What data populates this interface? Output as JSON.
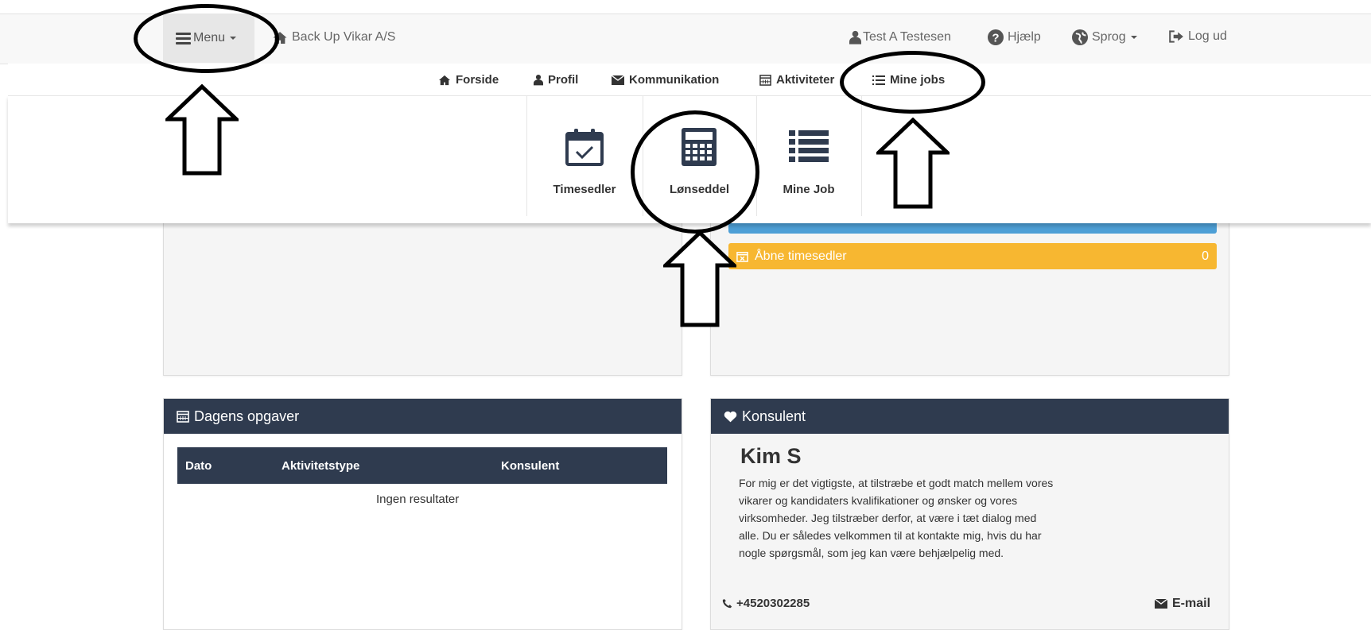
{
  "topbar": {
    "menu_label": "Menu",
    "company": "Back Up Vikar A/S",
    "user": "Test A Testesen",
    "help": "Hjælp",
    "language": "Sprog",
    "logout": "Log ud"
  },
  "subnav": {
    "items": [
      {
        "label": "Forside",
        "icon": "home-icon"
      },
      {
        "label": "Profil",
        "icon": "user-icon"
      },
      {
        "label": "Kommunikation",
        "icon": "envelope-icon"
      },
      {
        "label": "Aktiviteter",
        "icon": "calendar-icon"
      },
      {
        "label": "Mine jobs",
        "icon": "list-icon"
      }
    ]
  },
  "dropdown": {
    "tiles": [
      {
        "label": "Timesedler",
        "icon": "calendar-check-icon"
      },
      {
        "label": "Lønseddel",
        "icon": "calculator-icon"
      },
      {
        "label": "Mine Job",
        "icon": "list-icon"
      }
    ]
  },
  "status_bars": {
    "open_timesheets": {
      "label": "Åbne timesedler",
      "count": "0",
      "color": "#f7b731"
    },
    "blue_bar_color": "#2f8fd0"
  },
  "tasks_panel": {
    "title": "Dagens opgaver",
    "columns": [
      "Dato",
      "Aktivitetstype",
      "Konsulent"
    ],
    "empty_text": "Ingen resultater"
  },
  "consultant_panel": {
    "title": "Konsulent",
    "name": "Kim S",
    "bio_lines": [
      "For mig er det vigtigste, at tilstræbe et godt match mellem vores",
      "vikarer og kandidaters kvalifikationer og ønsker og vores",
      "virksomheder. Jeg tilstræber derfor, at være i tæt dialog med",
      "alle. Du er således velkommen til at kontakte mig, hvis du har",
      "nogle spørgsmål, som jeg kan være behjælpelig med."
    ],
    "phone": "+4520302285",
    "email_label": "E-mail"
  },
  "colors": {
    "navy": "#2f3b4f",
    "orange": "#f7b731",
    "blue": "#2f8fd0"
  }
}
